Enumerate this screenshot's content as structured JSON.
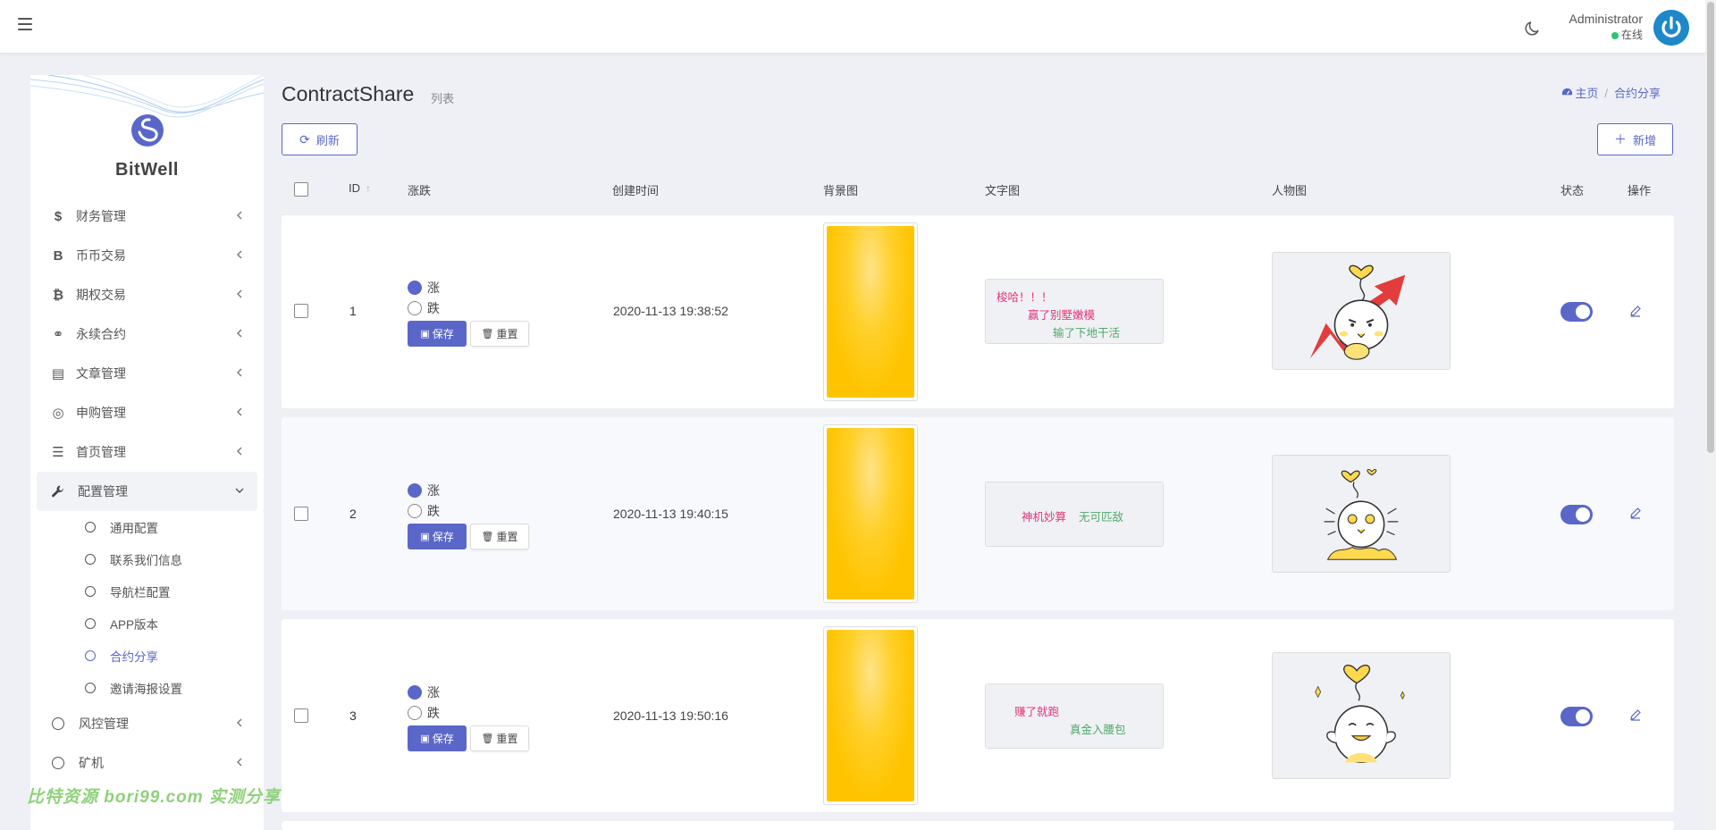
{
  "topbar": {
    "user_name": "Administrator",
    "user_status": "在线"
  },
  "colors": {
    "accent": "#5a67c8",
    "online": "#28c76f",
    "avatar": "#1e88c9",
    "watermark": "#8fd17a"
  },
  "sidebar": {
    "brand": "BitWell",
    "items": [
      {
        "label": "财务管理",
        "icon": "dollar-icon",
        "glyph": "$"
      },
      {
        "label": "币币交易",
        "icon": "bitcoin-b-icon",
        "glyph": "B"
      },
      {
        "label": "期权交易",
        "icon": "bitcoin-icon",
        "glyph": "₿"
      },
      {
        "label": "永续合约",
        "icon": "link-icon",
        "glyph": "⚭"
      },
      {
        "label": "文章管理",
        "icon": "newspaper-icon",
        "glyph": "▤"
      },
      {
        "label": "申购管理",
        "icon": "lifebuoy-icon",
        "glyph": "◎"
      },
      {
        "label": "首页管理",
        "icon": "list-icon",
        "glyph": "☰"
      },
      {
        "label": "配置管理",
        "icon": "wrench-icon",
        "glyph": "🔧"
      }
    ],
    "sub_items": [
      {
        "label": "通用配置"
      },
      {
        "label": "联系我们信息"
      },
      {
        "label": "导航栏配置"
      },
      {
        "label": "APP版本"
      },
      {
        "label": "合约分享",
        "active": true
      },
      {
        "label": "邀请海报设置"
      }
    ],
    "bottom_items": [
      {
        "label": "风控管理"
      },
      {
        "label": "矿机"
      }
    ]
  },
  "watermark": "比特资源 bori99.com 实测分享",
  "header": {
    "title": "ContractShare",
    "subtitle": "列表",
    "breadcrumb_home": "主页",
    "breadcrumb_current": "合约分享",
    "refresh_label": "刷新",
    "add_label": "新增"
  },
  "table": {
    "columns": [
      "ID",
      "涨跌",
      "创建时间",
      "背景图",
      "文字图",
      "人物图",
      "状态",
      "操作"
    ],
    "rise_label": "涨",
    "fall_label": "跌",
    "save_label": "保存",
    "reset_label": "重置",
    "rows": [
      {
        "id": "1",
        "direction": "rise",
        "created": "2020-11-13 19:38:52",
        "text_lines": [
          "梭哈！！！",
          "赢了别墅嫩模",
          "输了下地干活"
        ],
        "character": "rocket-arrow-chick",
        "enabled": true
      },
      {
        "id": "2",
        "direction": "rise",
        "created": "2020-11-13 19:40:15",
        "text_lines": [
          "神机妙算",
          "无可匹敌"
        ],
        "character": "coin-eyes-chick",
        "enabled": true
      },
      {
        "id": "3",
        "direction": "rise",
        "created": "2020-11-13 19:50:16",
        "text_lines": [
          "赚了就跑",
          "真金入腰包"
        ],
        "character": "happy-heart-chick",
        "enabled": true
      }
    ]
  }
}
